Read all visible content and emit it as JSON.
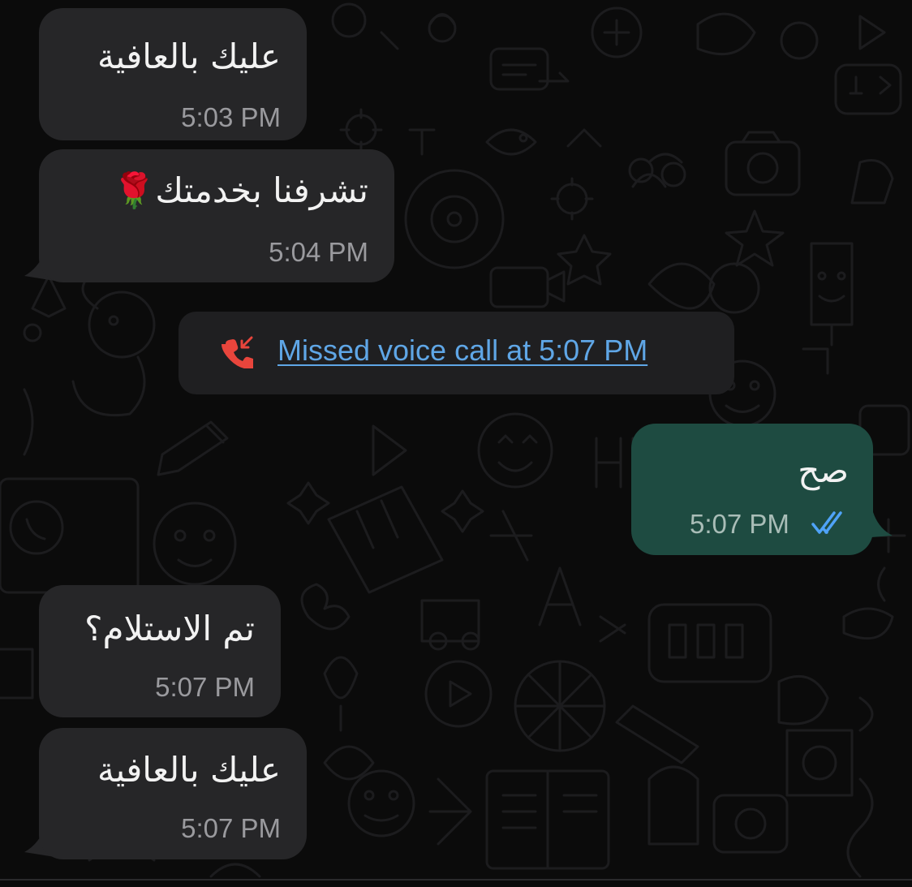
{
  "messages": [
    {
      "direction": "incoming",
      "text": "عليك بالعافية",
      "time": "5:03 PM"
    },
    {
      "direction": "incoming",
      "text": "تشرفنا بخدمتك🌹",
      "time": "5:04 PM"
    },
    {
      "direction": "system",
      "text": "Missed voice call at 5:07 PM",
      "icon": "missed-call-icon"
    },
    {
      "direction": "outgoing",
      "text": "صح",
      "time": "5:07 PM",
      "status": "read",
      "status_icon": "double-check-icon"
    },
    {
      "direction": "incoming",
      "text": "تم الاستلام؟",
      "time": "5:07 PM"
    },
    {
      "direction": "incoming",
      "text": "عليك بالعافية",
      "time": "5:07 PM"
    }
  ],
  "colors": {
    "background": "#0b0b0b",
    "incoming_bubble": "#262628",
    "outgoing_bubble": "#1e4b41",
    "link_blue": "#5fa6e6",
    "missed_call_red": "#e8453c",
    "read_check": "#4fa3f7"
  }
}
